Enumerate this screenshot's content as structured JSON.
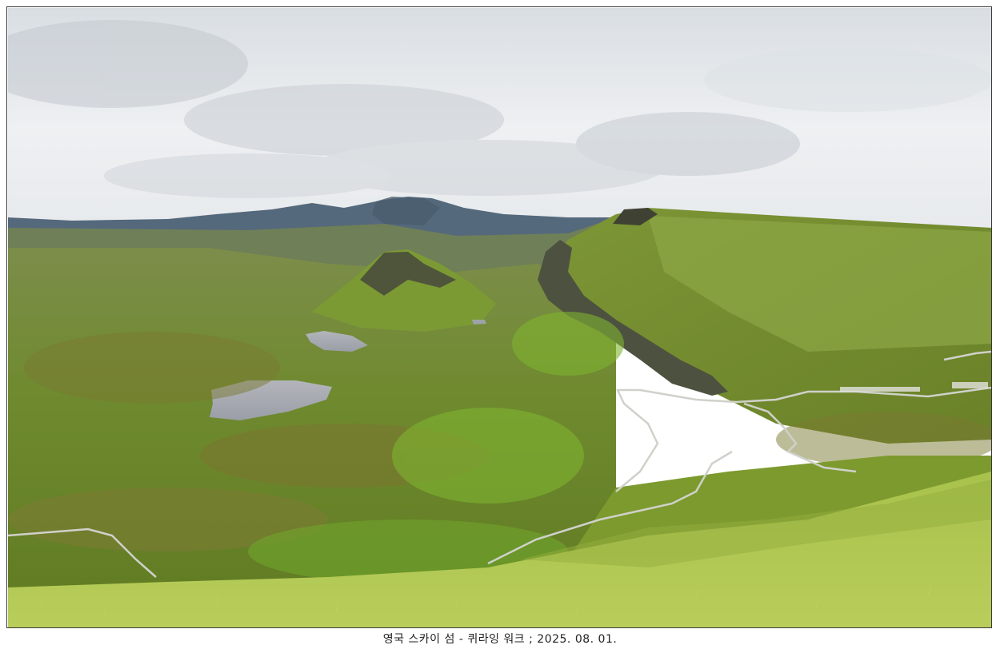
{
  "caption": {
    "text": "영국 스카이 섬 - 퀴라잉 워크 ; 2025. 08. 01."
  },
  "photo": {
    "subject": "landscape-photo",
    "colors": {
      "sky": "#e9ecef",
      "cloud_shadow": "#b9c0c7",
      "distant_mountains": "#4f6478",
      "grass_light": "#a9c24a",
      "grass_mid": "#7f9a34",
      "grass_dark": "#5a6e22",
      "moor_brown": "#7a7a32",
      "lake": "#a9acb3",
      "cliff": "#4b4d3c",
      "road": "#c9cbc4"
    }
  }
}
